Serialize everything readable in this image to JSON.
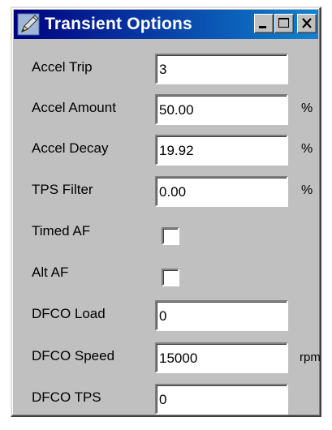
{
  "window": {
    "title": "Transient Options",
    "title_icon": "pencil-icon",
    "buttons": [
      "minimize-button",
      "maximize-button",
      "close-button"
    ]
  },
  "fields": [
    {
      "label": "Accel Trip",
      "type": "text",
      "value": "3",
      "unit": ""
    },
    {
      "label": "Accel Amount",
      "type": "text",
      "value": "50.00",
      "unit": "%"
    },
    {
      "label": "Accel Decay",
      "type": "text",
      "value": "19.92",
      "unit": "%"
    },
    {
      "label": "TPS Filter",
      "type": "text",
      "value": "0.00",
      "unit": "%"
    },
    {
      "label": "Timed AF",
      "type": "checkbox",
      "checked": false
    },
    {
      "label": "Alt AF",
      "type": "checkbox",
      "checked": false
    },
    {
      "label": "DFCO Load",
      "type": "text",
      "value": "0",
      "unit": ""
    },
    {
      "label": "DFCO Speed",
      "type": "text",
      "value": "15000",
      "unit": "rpm"
    },
    {
      "label": "DFCO TPS",
      "type": "text",
      "value": "0",
      "unit": ""
    }
  ],
  "colors": {
    "titlebar_start": "#000080",
    "titlebar_end": "#1084d0",
    "face": "#c0c0c0"
  }
}
